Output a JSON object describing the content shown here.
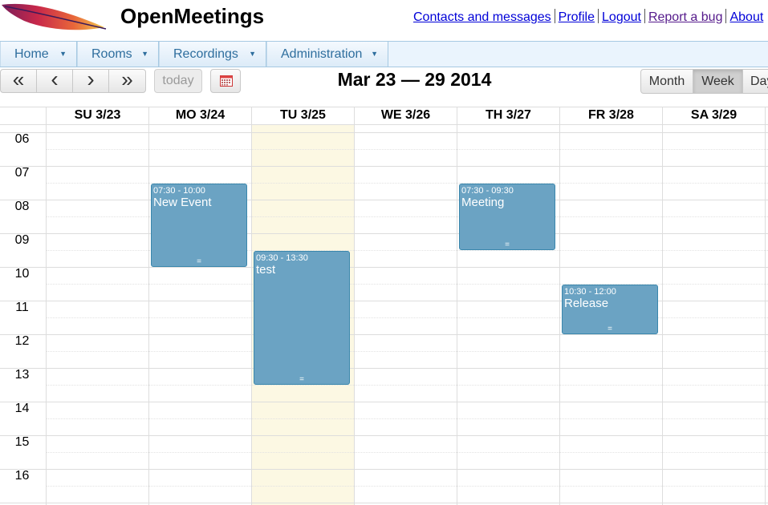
{
  "app": {
    "title": "OpenMeetings"
  },
  "top_links": [
    {
      "label": "Contacts and messages"
    },
    {
      "label": "Profile"
    },
    {
      "label": "Logout"
    },
    {
      "label": "Report a bug"
    },
    {
      "label": "About"
    }
  ],
  "menu": [
    {
      "label": "Home"
    },
    {
      "label": "Rooms"
    },
    {
      "label": "Recordings"
    },
    {
      "label": "Administration"
    }
  ],
  "toolbar": {
    "today_label": "today",
    "prev_year_icon": "«",
    "prev_icon": "‹",
    "next_icon": "›",
    "next_year_icon": "»",
    "range_title": "Mar 23 — 29 2014",
    "views": [
      {
        "label": "Month"
      },
      {
        "label": "Week",
        "active": true
      },
      {
        "label": "Day"
      }
    ]
  },
  "calendar": {
    "days": [
      "SU 3/23",
      "MO 3/24",
      "TU 3/25",
      "WE 3/26",
      "TH 3/27",
      "FR 3/28",
      "SA 3/29"
    ],
    "today_index": 2,
    "hours": [
      "06",
      "07",
      "08",
      "09",
      "10",
      "11",
      "12",
      "13",
      "14",
      "15",
      "16"
    ],
    "events": [
      {
        "time": "07:30 - 10:00",
        "title": "New Event"
      },
      {
        "time": "09:30 - 13:30",
        "title": "test"
      },
      {
        "time": "07:30 - 09:30",
        "title": "Meeting"
      },
      {
        "time": "10:30 - 12:00",
        "title": "Release"
      }
    ],
    "resize_handle": "="
  },
  "colors": {
    "event_bg": "#6ba3c3",
    "event_border": "#3a87ad",
    "today_bg": "#fcf8e3",
    "menu_text": "#2e6e9e",
    "link": "#0000d8"
  }
}
